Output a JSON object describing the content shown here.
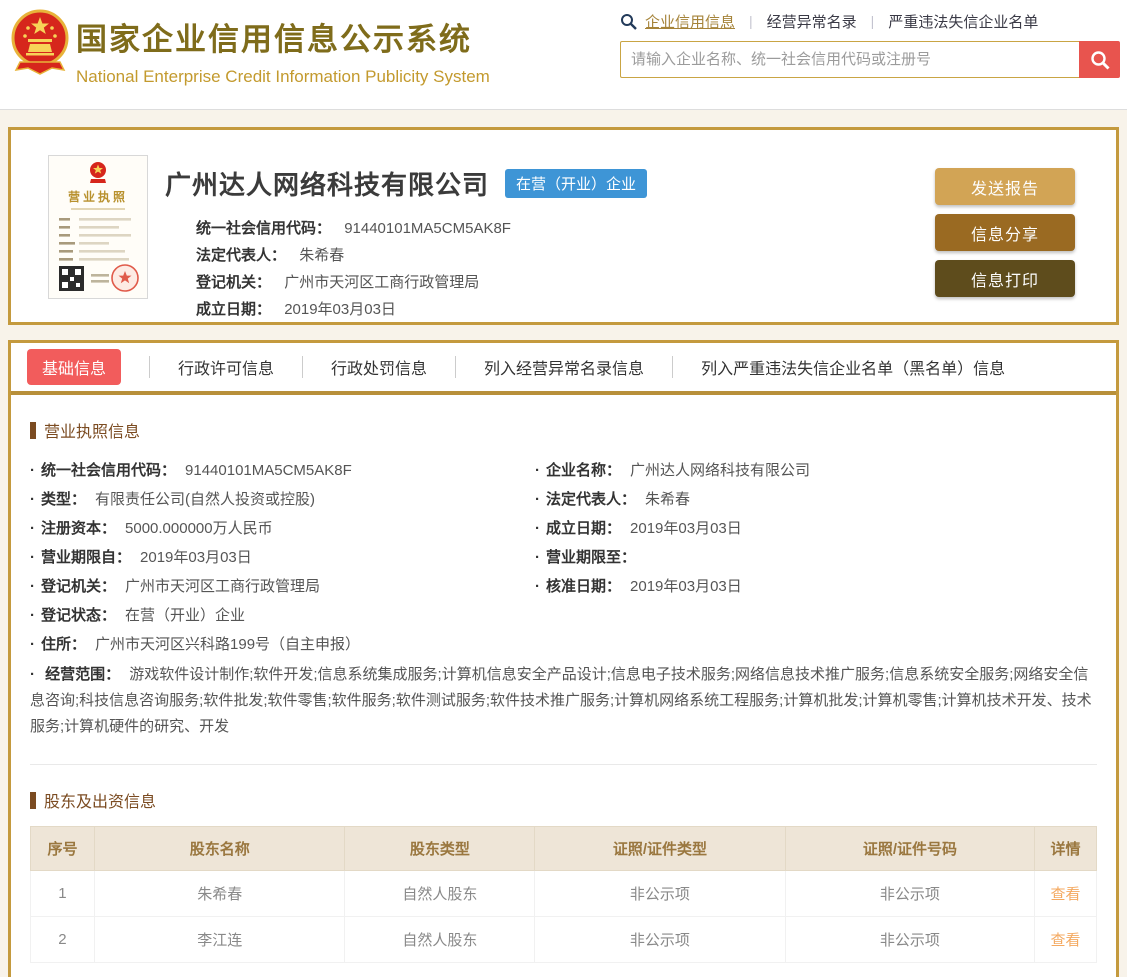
{
  "colors": {
    "gold_border": "#c49a3e",
    "page_background": "#f8f3ea",
    "title_gold": "#7f6c1b",
    "subtitle_gold": "#c39a2e",
    "active_tab_red": "#f25c5c",
    "search_button_red": "#e8544e",
    "status_badge_blue": "#3e95d6",
    "section_heading_brown": "#7b4b21",
    "table_header_bg": "#eee5d7",
    "table_header_text": "#9a773f",
    "view_link_orange": "#f4a960",
    "button_send_report": "#d2a455",
    "button_info_share": "#9a6a22",
    "button_info_print": "#5e4c1c"
  },
  "header": {
    "title": "国家企业信用信息公示系统",
    "subtitle": "National Enterprise Credit Information Publicity System",
    "nav": [
      {
        "label": "企业信用信息"
      },
      {
        "label": "经营异常名录"
      },
      {
        "label": "严重违法失信企业名单"
      }
    ],
    "search": {
      "placeholder": "请输入企业名称、统一社会信用代码或注册号"
    }
  },
  "company_card": {
    "license_caption": "营业执照",
    "name": "广州达人网络科技有限公司",
    "status_badge": "在营（开业）企业",
    "fields": [
      {
        "label": "统一社会信用代码：",
        "value": "91440101MA5CM5AK8F"
      },
      {
        "label": "法定代表人：",
        "value": "朱希春"
      },
      {
        "label": "登记机关：",
        "value": "广州市天河区工商行政管理局"
      },
      {
        "label": "成立日期：",
        "value": "2019年03月03日"
      }
    ],
    "buttons": [
      {
        "label": "发送报告"
      },
      {
        "label": "信息分享"
      },
      {
        "label": "信息打印"
      }
    ]
  },
  "tabs": [
    {
      "label": "基础信息",
      "active": true
    },
    {
      "label": "行政许可信息",
      "active": false
    },
    {
      "label": "行政处罚信息",
      "active": false
    },
    {
      "label": "列入经营异常名录信息",
      "active": false
    },
    {
      "label": "列入严重违法失信企业名单（黑名单）信息",
      "active": false
    }
  ],
  "license_info": {
    "section_title": "营业执照信息",
    "left_fields": [
      {
        "label": "统一社会信用代码：",
        "value": "91440101MA5CM5AK8F"
      },
      {
        "label": "类型：",
        "value": "有限责任公司(自然人投资或控股)"
      },
      {
        "label": "注册资本：",
        "value": "5000.000000万人民币"
      },
      {
        "label": "营业期限自：",
        "value": "2019年03月03日"
      },
      {
        "label": "登记机关：",
        "value": "广州市天河区工商行政管理局"
      },
      {
        "label": "登记状态：",
        "value": "在营（开业）企业"
      },
      {
        "label": "住所：",
        "value": "广州市天河区兴科路199号（自主申报）"
      }
    ],
    "right_fields": [
      {
        "label": "企业名称：",
        "value": "广州达人网络科技有限公司"
      },
      {
        "label": "法定代表人：",
        "value": "朱希春"
      },
      {
        "label": "成立日期：",
        "value": "2019年03月03日"
      },
      {
        "label": "营业期限至：",
        "value": ""
      },
      {
        "label": "核准日期：",
        "value": "2019年03月03日"
      }
    ],
    "scope": {
      "label": "经营范围：",
      "value": "游戏软件设计制作;软件开发;信息系统集成服务;计算机信息安全产品设计;信息电子技术服务;网络信息技术推广服务;信息系统安全服务;网络安全信息咨询;科技信息咨询服务;软件批发;软件零售;软件服务;软件测试服务;软件技术推广服务;计算机网络系统工程服务;计算机批发;计算机零售;计算机技术开发、技术服务;计算机硬件的研究、开发"
    }
  },
  "shareholders": {
    "section_title": "股东及出资信息",
    "columns": [
      "序号",
      "股东名称",
      "股东类型",
      "证照/证件类型",
      "证照/证件号码",
      "详情"
    ],
    "rows": [
      {
        "no": "1",
        "name": "朱希春",
        "type": "自然人股东",
        "cert_type": "非公示项",
        "cert_no": "非公示项",
        "detail": "查看"
      },
      {
        "no": "2",
        "name": "李江连",
        "type": "自然人股东",
        "cert_type": "非公示项",
        "cert_no": "非公示项",
        "detail": "查看"
      }
    ]
  }
}
